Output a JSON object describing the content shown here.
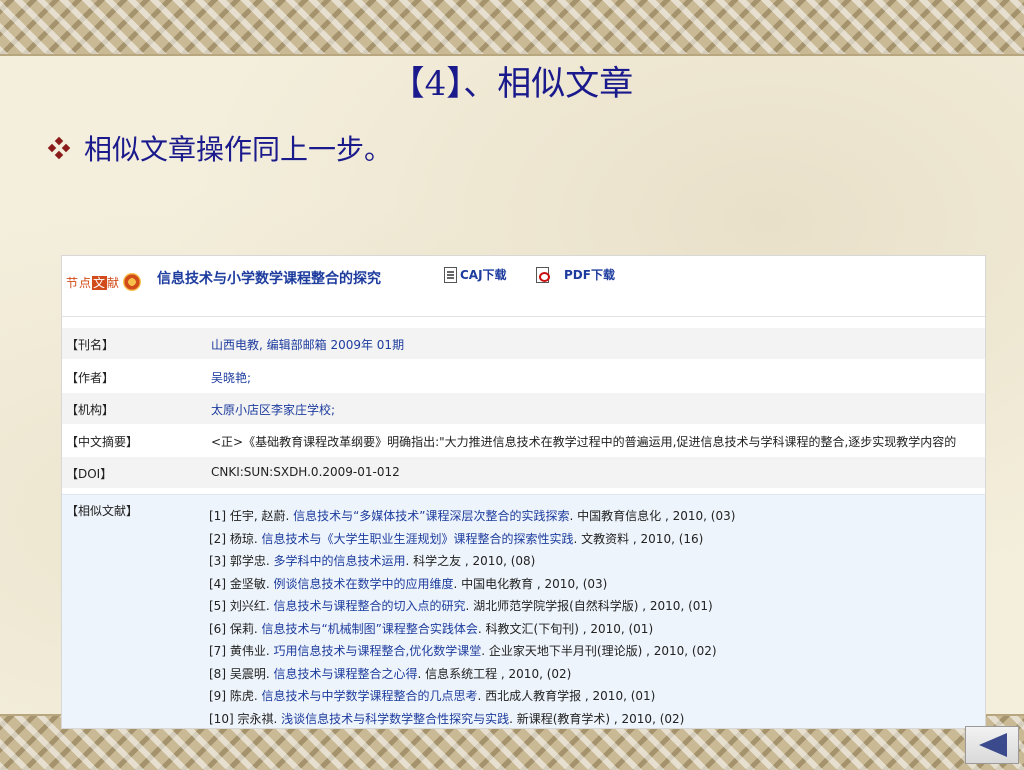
{
  "slide": {
    "title": "【4】、相似文章",
    "bullet": "相似文章操作同上一步。",
    "back_icon": "triangle-left-icon"
  },
  "header": {
    "logo_prefix": "节点",
    "logo_highlight": "文",
    "logo_suffix": "献",
    "article_title": "信息技术与小学数学课程整合的探究",
    "caj_label": "CAJ下载",
    "pdf_label": "PDF下载"
  },
  "meta": [
    {
      "key": "【刊名】",
      "value": "山西电教, 编辑部邮箱  2009年  01期"
    },
    {
      "key": "【作者】",
      "value": "吴晓艳;"
    },
    {
      "key": "【机构】",
      "value": "太原小店区李家庄学校;"
    },
    {
      "key": "【中文摘要】",
      "value": "<正>《基础教育课程改革纲要》明确指出:\"大力推进信息技术在教学过程中的普遍运用,促进信息技术与学科课程的整合,逐步实现教学内容的"
    },
    {
      "key": "【DOI】",
      "value": "CNKI:SUN:SXDH.0.2009-01-012"
    }
  ],
  "similar": {
    "key": "【相似文献】",
    "items": [
      {
        "pre": "[1] 任宇, 赵蔚. ",
        "title": "信息技术与“多媒体技术”课程深层次整合的实践探索",
        "post": ". 中国教育信息化 , 2010, (03)"
      },
      {
        "pre": "[2] 杨琼. ",
        "title": "信息技术与《大学生职业生涯规划》课程整合的探索性实践",
        "post": ". 文教资料 , 2010, (16)"
      },
      {
        "pre": "[3] 郭学忠. ",
        "title": "多学科中的信息技术运用",
        "post": ". 科学之友 , 2010, (08)"
      },
      {
        "pre": "[4] 金坚敏. ",
        "title": "例谈信息技术在数学中的应用维度",
        "post": ". 中国电化教育 , 2010, (03)"
      },
      {
        "pre": "[5] 刘兴红. ",
        "title": "信息技术与课程整合的切入点的研究",
        "post": ". 湖北师范学院学报(自然科学版) , 2010, (01)"
      },
      {
        "pre": "[6] 保莉. ",
        "title": "信息技术与“机械制图”课程整合实践体会",
        "post": ". 科教文汇(下旬刊) , 2010, (01)"
      },
      {
        "pre": "[7] 黄伟业. ",
        "title": "巧用信息技术与课程整合,优化数学课堂",
        "post": ". 企业家天地下半月刊(理论版) , 2010, (02)"
      },
      {
        "pre": "[8] 吴震明. ",
        "title": "信息技术与课程整合之心得",
        "post": ". 信息系统工程 , 2010, (02)"
      },
      {
        "pre": "[9] 陈虎. ",
        "title": "信息技术与中学数学课程整合的几点思考",
        "post": ". 西北成人教育学报 , 2010, (01)"
      },
      {
        "pre": "[10] 宗永祺. ",
        "title": "浅谈信息技术与科学数学整合性探究与实践",
        "post": ". 新课程(教育学术) , 2010, (02)"
      }
    ]
  }
}
